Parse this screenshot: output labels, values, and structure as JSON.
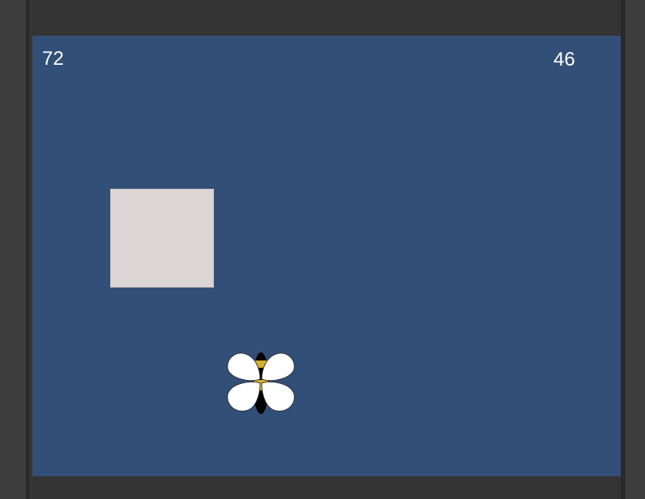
{
  "hud": {
    "left_value": "72",
    "right_value": "46"
  },
  "scene": {
    "background_color": "#324f77",
    "block_color": "#dbd6d5",
    "player": "bee-icon"
  }
}
